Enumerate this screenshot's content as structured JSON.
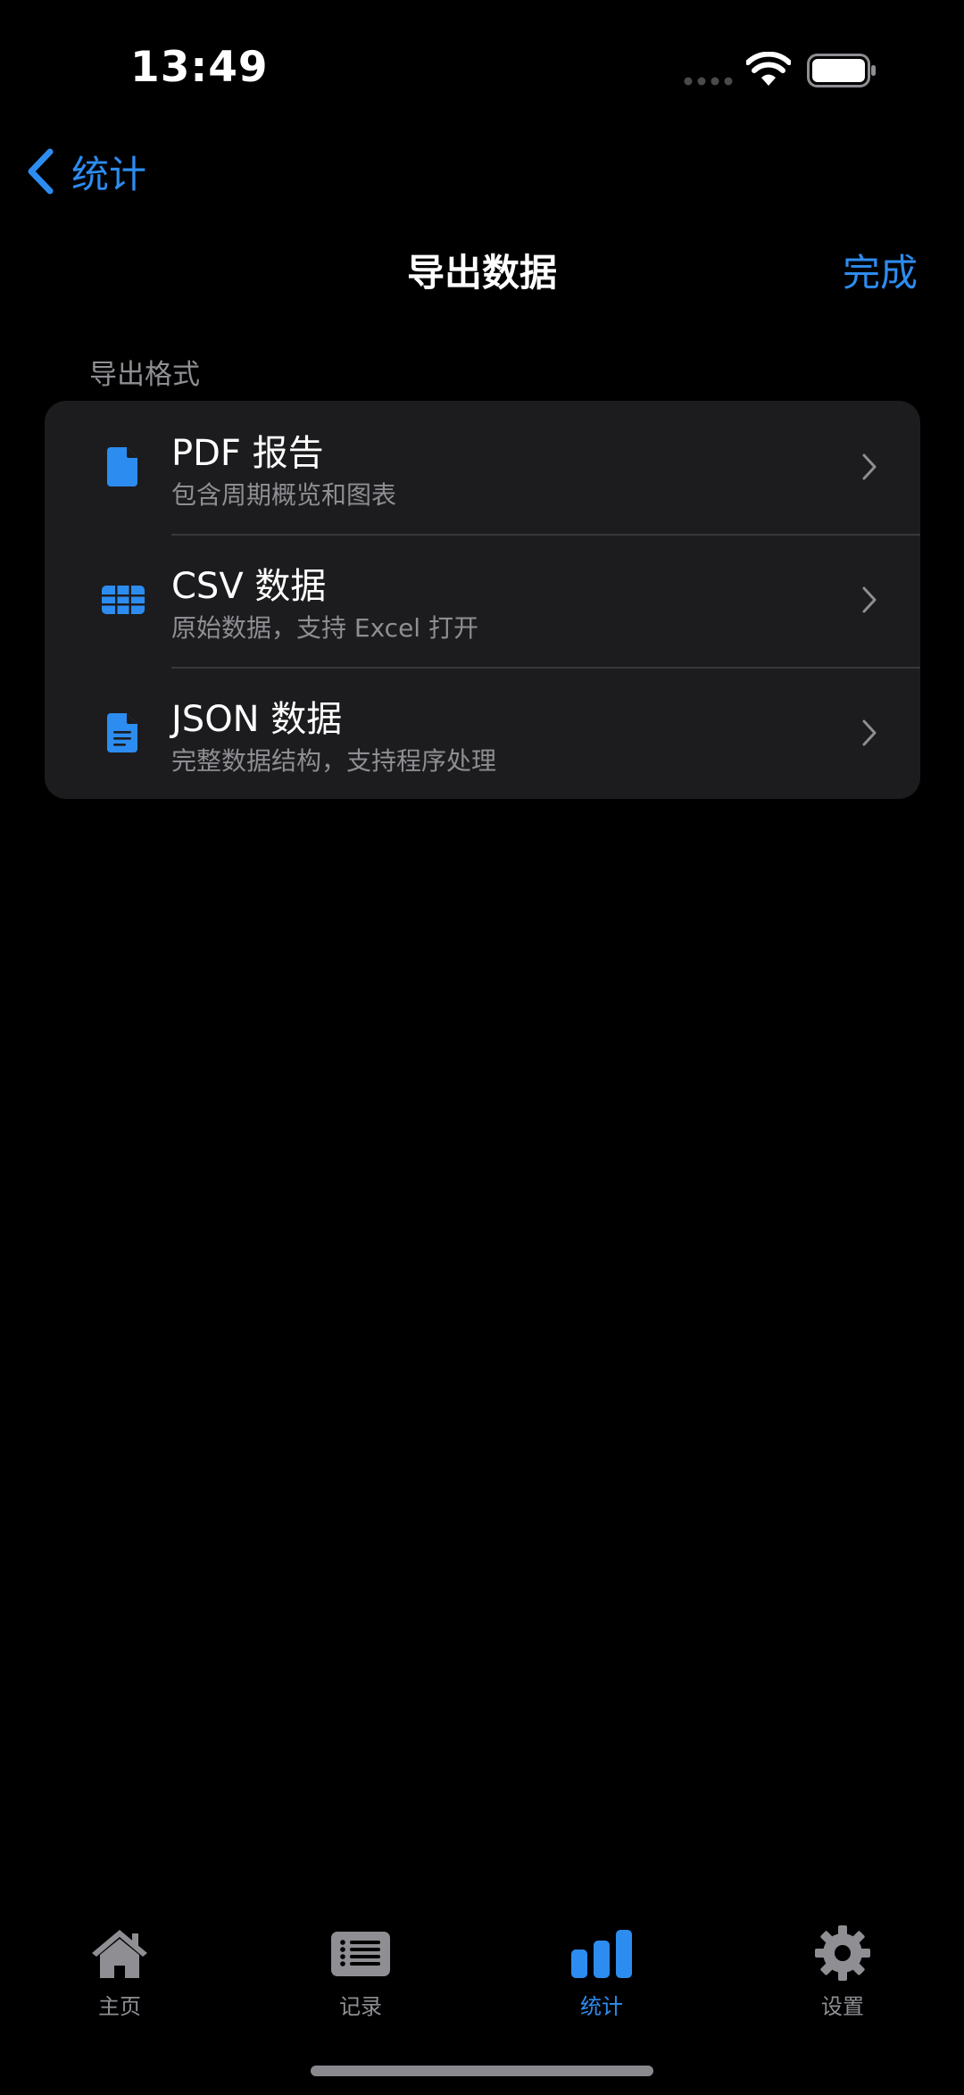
{
  "status_bar": {
    "time": "13:49"
  },
  "nav": {
    "back_label": "统计",
    "title": "导出数据",
    "done_label": "完成"
  },
  "section": {
    "header": "导出格式",
    "items": [
      {
        "title": "PDF 报告",
        "subtitle": "包含周期概览和图表",
        "icon": "pdf-document-icon"
      },
      {
        "title": "CSV 数据",
        "subtitle": "原始数据，支持 Excel 打开",
        "icon": "table-icon"
      },
      {
        "title": "JSON 数据",
        "subtitle": "完整数据结构，支持程序处理",
        "icon": "text-document-icon"
      }
    ]
  },
  "tab_bar": {
    "active": "stats",
    "tabs": [
      {
        "id": "home",
        "label": "主页",
        "icon": "house-icon"
      },
      {
        "id": "records",
        "label": "记录",
        "icon": "list-icon"
      },
      {
        "id": "stats",
        "label": "统计",
        "icon": "bar-chart-icon"
      },
      {
        "id": "settings",
        "label": "设置",
        "icon": "gear-icon"
      }
    ]
  },
  "colors": {
    "accent": "#2d8cf0",
    "background": "#000000",
    "card": "#1c1c1e",
    "secondary_text": "#8e8e93"
  }
}
